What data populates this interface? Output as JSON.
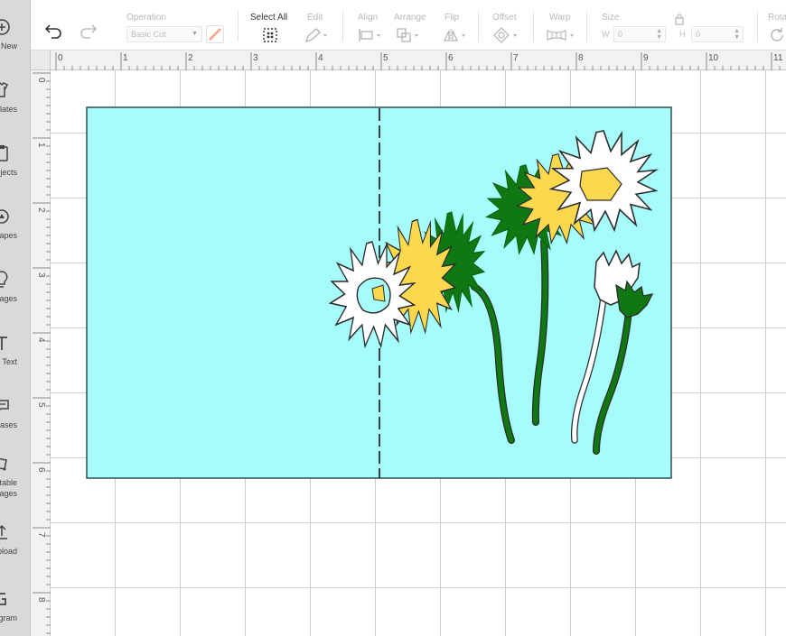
{
  "sidebar": {
    "items": [
      {
        "icon": "plus-circle-icon",
        "label": "New",
        "label_line2": ""
      },
      {
        "icon": "shirt-icon",
        "label": "Templates",
        "label_line2": ""
      },
      {
        "icon": "clipboard-icon",
        "label": "Projects",
        "label_line2": ""
      },
      {
        "icon": "shapes-icon",
        "label": "Shapes",
        "label_line2": ""
      },
      {
        "icon": "lightbulb-icon",
        "label": "Images",
        "label_line2": ""
      },
      {
        "icon": "text-icon",
        "label": "Text",
        "label_line2": ""
      },
      {
        "icon": "phrases-icon",
        "label": "Phrases",
        "label_line2": ""
      },
      {
        "icon": "editable-images-icon",
        "label": "Editable",
        "label_line2": "Images"
      },
      {
        "icon": "upload-icon",
        "label": "Upload",
        "label_line2": ""
      },
      {
        "icon": "monogram-icon",
        "label": "Monogram",
        "label_line2": ""
      }
    ]
  },
  "toolbar": {
    "operation_label": "Operation",
    "operation_value": "Basic Cut",
    "select_all_label": "Select All",
    "edit_label": "Edit",
    "align_label": "Align",
    "arrange_label": "Arrange",
    "flip_label": "Flip",
    "offset_label": "Offset",
    "warp_label": "Warp",
    "size_label": "Size",
    "size_w_label": "W",
    "size_w_value": "0",
    "size_h_label": "H",
    "size_h_value": "0",
    "rotate_label": "Rotate"
  },
  "ruler": {
    "top_numbers": [
      "0",
      "1",
      "2",
      "3",
      "4",
      "5",
      "6",
      "7",
      "8",
      "9",
      "10",
      "11"
    ],
    "left_numbers": [
      "0",
      "1",
      "2",
      "3",
      "4",
      "5",
      "6",
      "7",
      "8"
    ]
  },
  "colors": {
    "card": "#a6fbfb",
    "yellow_petals": "#fcd84f",
    "green_leaves": "#0f7812",
    "white_petals": "#ffffff",
    "outline": "#2b2b2b"
  }
}
